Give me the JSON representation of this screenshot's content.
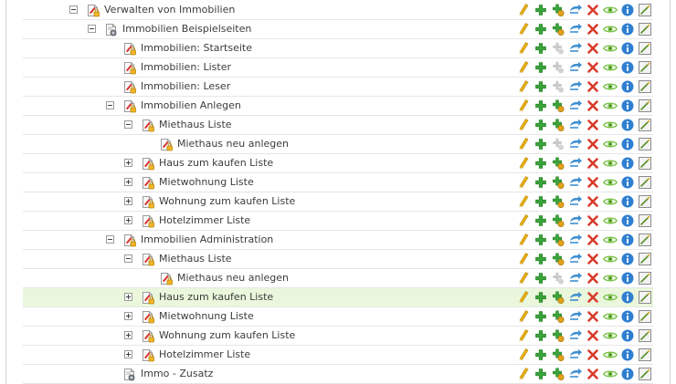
{
  "tree": {
    "rows": [
      {
        "label": "Verwalten von Immobilien",
        "level": 0,
        "expander": "minus",
        "icon": "page-lock-icon",
        "highlight": false,
        "add_sub_enabled": true
      },
      {
        "label": "Immobilien Beispielseiten",
        "level": 1,
        "expander": "minus",
        "icon": "page-gear-icon",
        "highlight": false,
        "add_sub_enabled": true
      },
      {
        "label": "Immobilien: Startseite",
        "level": 2,
        "expander": "none",
        "icon": "page-lock-icon",
        "highlight": false,
        "add_sub_enabled": false
      },
      {
        "label": "Immobilien: Lister",
        "level": 2,
        "expander": "none",
        "icon": "page-lock-icon",
        "highlight": false,
        "add_sub_enabled": false
      },
      {
        "label": "Immobilien: Leser",
        "level": 2,
        "expander": "none",
        "icon": "page-lock-icon",
        "highlight": false,
        "add_sub_enabled": false
      },
      {
        "label": "Immobilien Anlegen",
        "level": 2,
        "expander": "minus",
        "icon": "page-lock-icon",
        "highlight": false,
        "add_sub_enabled": true
      },
      {
        "label": "Miethaus Liste",
        "level": 3,
        "expander": "minus",
        "icon": "page-lock-icon",
        "highlight": false,
        "add_sub_enabled": true
      },
      {
        "label": "Miethaus neu anlegen",
        "level": 4,
        "expander": "none",
        "icon": "page-lock-icon",
        "highlight": false,
        "add_sub_enabled": false
      },
      {
        "label": "Haus zum kaufen Liste",
        "level": 3,
        "expander": "plus",
        "icon": "page-lock-icon",
        "highlight": false,
        "add_sub_enabled": true
      },
      {
        "label": "Mietwohnung Liste",
        "level": 3,
        "expander": "plus",
        "icon": "page-lock-icon",
        "highlight": false,
        "add_sub_enabled": true
      },
      {
        "label": "Wohnung zum kaufen Liste",
        "level": 3,
        "expander": "plus",
        "icon": "page-lock-icon",
        "highlight": false,
        "add_sub_enabled": true
      },
      {
        "label": "Hotelzimmer Liste",
        "level": 3,
        "expander": "plus",
        "icon": "page-lock-icon",
        "highlight": false,
        "add_sub_enabled": true
      },
      {
        "label": "Immobilien Administration",
        "level": 2,
        "expander": "minus",
        "icon": "page-lock-icon",
        "highlight": false,
        "add_sub_enabled": true
      },
      {
        "label": "Miethaus Liste",
        "level": 3,
        "expander": "minus",
        "icon": "page-lock-icon",
        "highlight": false,
        "add_sub_enabled": true
      },
      {
        "label": "Miethaus neu anlegen",
        "level": 4,
        "expander": "none",
        "icon": "page-lock-icon",
        "highlight": false,
        "add_sub_enabled": false
      },
      {
        "label": "Haus zum kaufen Liste",
        "level": 3,
        "expander": "plus",
        "icon": "page-lock-icon",
        "highlight": true,
        "add_sub_enabled": true
      },
      {
        "label": "Mietwohnung Liste",
        "level": 3,
        "expander": "plus",
        "icon": "page-lock-icon",
        "highlight": false,
        "add_sub_enabled": true
      },
      {
        "label": "Wohnung zum kaufen Liste",
        "level": 3,
        "expander": "plus",
        "icon": "page-lock-icon",
        "highlight": false,
        "add_sub_enabled": true
      },
      {
        "label": "Hotelzimmer Liste",
        "level": 3,
        "expander": "plus",
        "icon": "page-lock-icon",
        "highlight": false,
        "add_sub_enabled": true
      },
      {
        "label": "Immo - Zusatz",
        "level": 2,
        "expander": "none",
        "icon": "page-gear-icon",
        "highlight": false,
        "add_sub_enabled": true
      }
    ],
    "actions": [
      "edit-pencil-icon",
      "add-plus-icon",
      "add-subpage-icon",
      "move-arrow-icon",
      "delete-x-icon",
      "view-eye-icon",
      "info-icon",
      "properties-icon"
    ]
  },
  "colors": {
    "highlight_row": "#eaf7dc",
    "row_border": "#e6e6e6",
    "text": "#3c3c3c",
    "pencil": "#e8b010",
    "plus_green": "#3aa43a",
    "move_blue": "#3f8fd0",
    "delete_red": "#d83a2a",
    "eye_green": "#7bc14a",
    "info_blue": "#2f7fd1"
  }
}
